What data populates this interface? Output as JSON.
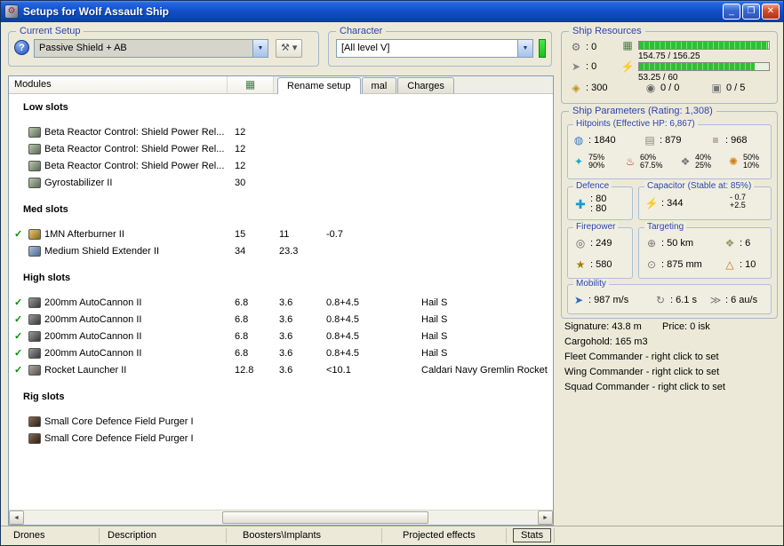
{
  "colors": {
    "titlebar_blue": "#1350CC",
    "green_indicator": "#1FD41F",
    "check_green": "#008C00",
    "label_blue": "#2E43B0"
  },
  "window": {
    "title": "Setups for Wolf Assault Ship"
  },
  "icons": {
    "app": "⚙",
    "minimize": "_",
    "maximize": "❐",
    "close": "✕",
    "help": "?",
    "tools": "⚒ ▾",
    "combo_arrow": "▼",
    "turret": "⚙",
    "launcher": "➤",
    "calibration": "◈",
    "cpu": "▦",
    "powergrid": "⚡",
    "drone": "◉",
    "slots": "▣",
    "shield": "◍",
    "armor": "▤",
    "structure": "≡",
    "em": "✦",
    "thermal": "♨",
    "kinetic": "❖",
    "explosive": "✺",
    "defence": "✚",
    "capacitor": "⚡",
    "volley": "◎",
    "dps": "★",
    "range": "⊕",
    "max_targets": "❖",
    "resolution": "⊙",
    "sensor": "△",
    "speed": "➤",
    "align": "↻",
    "warp": "≫",
    "check": "✓",
    "scroll_left": "◄",
    "scroll_right": "►"
  },
  "setup": {
    "label": "Current Setup",
    "value": "Passive Shield + AB"
  },
  "character": {
    "label": "Character",
    "value": "[All level V]"
  },
  "resources": {
    "label": "Ship Resources",
    "turrets": ": 0",
    "launchers": ": 0",
    "calibration": ": 300",
    "cpu": {
      "text": "154.75 / 156.25",
      "pct": 99
    },
    "powergrid": {
      "text": "53.25 / 60",
      "pct": 89
    },
    "drones": "0 / 0",
    "rigs": "0 / 5"
  },
  "params": {
    "label": "Ship Parameters (Rating: 1,308)",
    "hitpoints": {
      "label": "Hitpoints (Effective HP: 6,867)",
      "shield": ": 1840",
      "armor": ": 879",
      "structure": ": 968",
      "resists": [
        {
          "top": "75%",
          "bottom": "90%"
        },
        {
          "top": "60%",
          "bottom": "67.5%"
        },
        {
          "top": "40%",
          "bottom": "25%"
        },
        {
          "top": "50%",
          "bottom": "10%"
        }
      ]
    },
    "defence": {
      "label": "Defence",
      "top": ": 80",
      "bottom": ": 80"
    },
    "capacitor": {
      "label": "Capacitor (Stable at: 85%)",
      "value": ": 344",
      "delta_top": "- 0.7",
      "delta_bottom": "+2.5"
    },
    "firepower": {
      "label": "Firepower",
      "volley": ": 249",
      "dps": ": 580"
    },
    "targeting": {
      "label": "Targeting",
      "range": ": 50 km",
      "targets": ": 6",
      "resolution": ": 875 mm",
      "sensor": ": 10"
    },
    "mobility": {
      "label": "Mobility",
      "speed": ": 987 m/s",
      "align": ": 6.1 s",
      "warp": ": 6 au/s"
    }
  },
  "info": {
    "signature": "Signature: 43.8 m",
    "price": "Price: 0 isk",
    "cargohold": "Cargohold: 165 m3",
    "fleet": "Fleet Commander - right click to set",
    "wing": "Wing Commander - right click to set",
    "squad": "Squad Commander - right click to set"
  },
  "modules": {
    "header": "Modules",
    "tabs": {
      "rename": "Rename setup",
      "mid": "mal",
      "charges": "Charges"
    },
    "sections": [
      {
        "title": "Low slots",
        "rows": [
          {
            "name": "Beta Reactor Control: Shield Power Rel...",
            "c1": "12"
          },
          {
            "name": "Beta Reactor Control: Shield Power Rel...",
            "c1": "12"
          },
          {
            "name": "Beta Reactor Control: Shield Power Rel...",
            "c1": "12"
          },
          {
            "name": "Gyrostabilizer II",
            "c1": "30"
          }
        ]
      },
      {
        "title": "Med slots",
        "rows": [
          {
            "check": "✓",
            "name": "1MN Afterburner II",
            "c1": "15",
            "c2": "11",
            "c3": "-0.7"
          },
          {
            "name": "Medium Shield Extender II",
            "c1": "34",
            "c2": "23.3"
          }
        ]
      },
      {
        "title": "High slots",
        "rows": [
          {
            "check": "✓",
            "name": "200mm AutoCannon II",
            "c1": "6.8",
            "c2": "3.6",
            "c3": "0.8+4.5",
            "charge": "Hail S"
          },
          {
            "check": "✓",
            "name": "200mm AutoCannon II",
            "c1": "6.8",
            "c2": "3.6",
            "c3": "0.8+4.5",
            "charge": "Hail S"
          },
          {
            "check": "✓",
            "name": "200mm AutoCannon II",
            "c1": "6.8",
            "c2": "3.6",
            "c3": "0.8+4.5",
            "charge": "Hail S"
          },
          {
            "check": "✓",
            "name": "200mm AutoCannon II",
            "c1": "6.8",
            "c2": "3.6",
            "c3": "0.8+4.5",
            "charge": "Hail S"
          },
          {
            "check": "✓",
            "name": "Rocket Launcher II",
            "c1": "12.8",
            "c2": "3.6",
            "c3": "<10.1",
            "charge": "Caldari Navy Gremlin Rocket"
          }
        ]
      },
      {
        "title": "Rig slots",
        "rows": [
          {
            "name": "Small Core Defence Field Purger I"
          },
          {
            "name": "Small Core Defence Field Purger I"
          }
        ]
      }
    ]
  },
  "bottom_tabs": {
    "drones": "Drones",
    "description": "Description",
    "boosters": "Boosters\\Implants",
    "projected": "Projected effects",
    "stats": "Stats"
  }
}
